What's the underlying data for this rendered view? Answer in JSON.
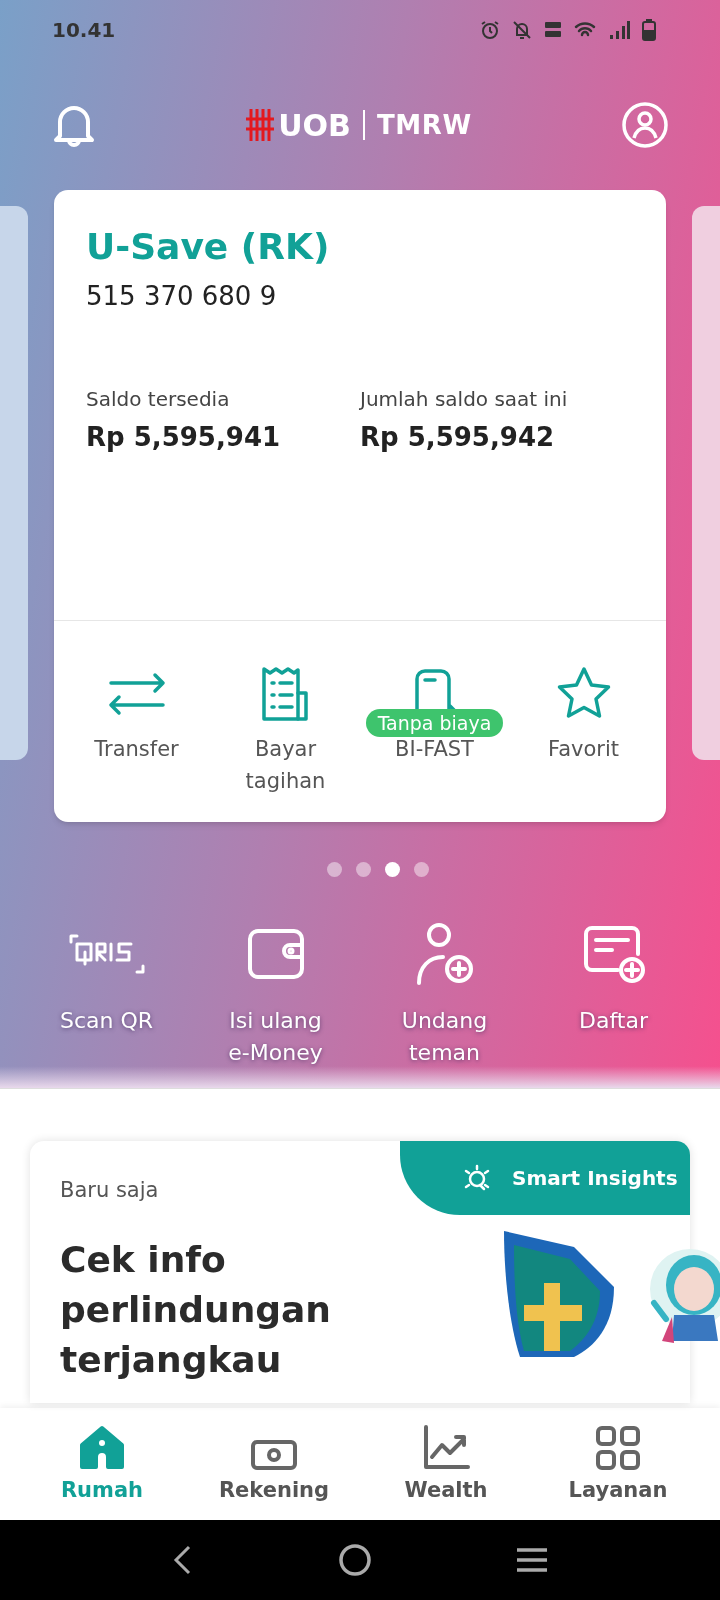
{
  "status_bar": {
    "time": "10.41"
  },
  "header": {
    "logo_left": "UOB",
    "logo_right": "TMRW"
  },
  "account_card": {
    "name": "U-Save (RK)",
    "number": "515 370 680 9",
    "balances": [
      {
        "label": "Saldo tersedia",
        "value": "Rp 5,595,941"
      },
      {
        "label": "Jumlah saldo saat ini",
        "value": "Rp 5,595,942"
      }
    ],
    "actions": [
      {
        "kind": "transfer",
        "label": "Transfer"
      },
      {
        "kind": "bill",
        "label": "Bayar tagihan"
      },
      {
        "kind": "bifast",
        "label": "BI-FAST",
        "badge": "Tanpa biaya"
      },
      {
        "kind": "favorite",
        "label": "Favorit"
      }
    ]
  },
  "pager": [
    {
      "selected": false
    },
    {
      "selected": false
    },
    {
      "selected": true
    },
    {
      "selected": false
    }
  ],
  "quick_actions": [
    {
      "kind": "qris",
      "label": "Scan QR"
    },
    {
      "kind": "wallet",
      "label": "Isi ulang e-Money"
    },
    {
      "kind": "invite",
      "label": "Undang teman"
    },
    {
      "kind": "register",
      "label": "Daftar"
    }
  ],
  "insight_card": {
    "time": "Baru saja",
    "tag": "Smart Insights",
    "headline": "Cek info perlindungan terjangkau"
  },
  "bottom_nav": [
    {
      "kind": "home",
      "label": "Rumah",
      "selected": true
    },
    {
      "kind": "account",
      "label": "Rekening",
      "selected": false
    },
    {
      "kind": "wealth",
      "label": "Wealth",
      "selected": false
    },
    {
      "kind": "services",
      "label": "Layanan",
      "selected": false
    }
  ]
}
